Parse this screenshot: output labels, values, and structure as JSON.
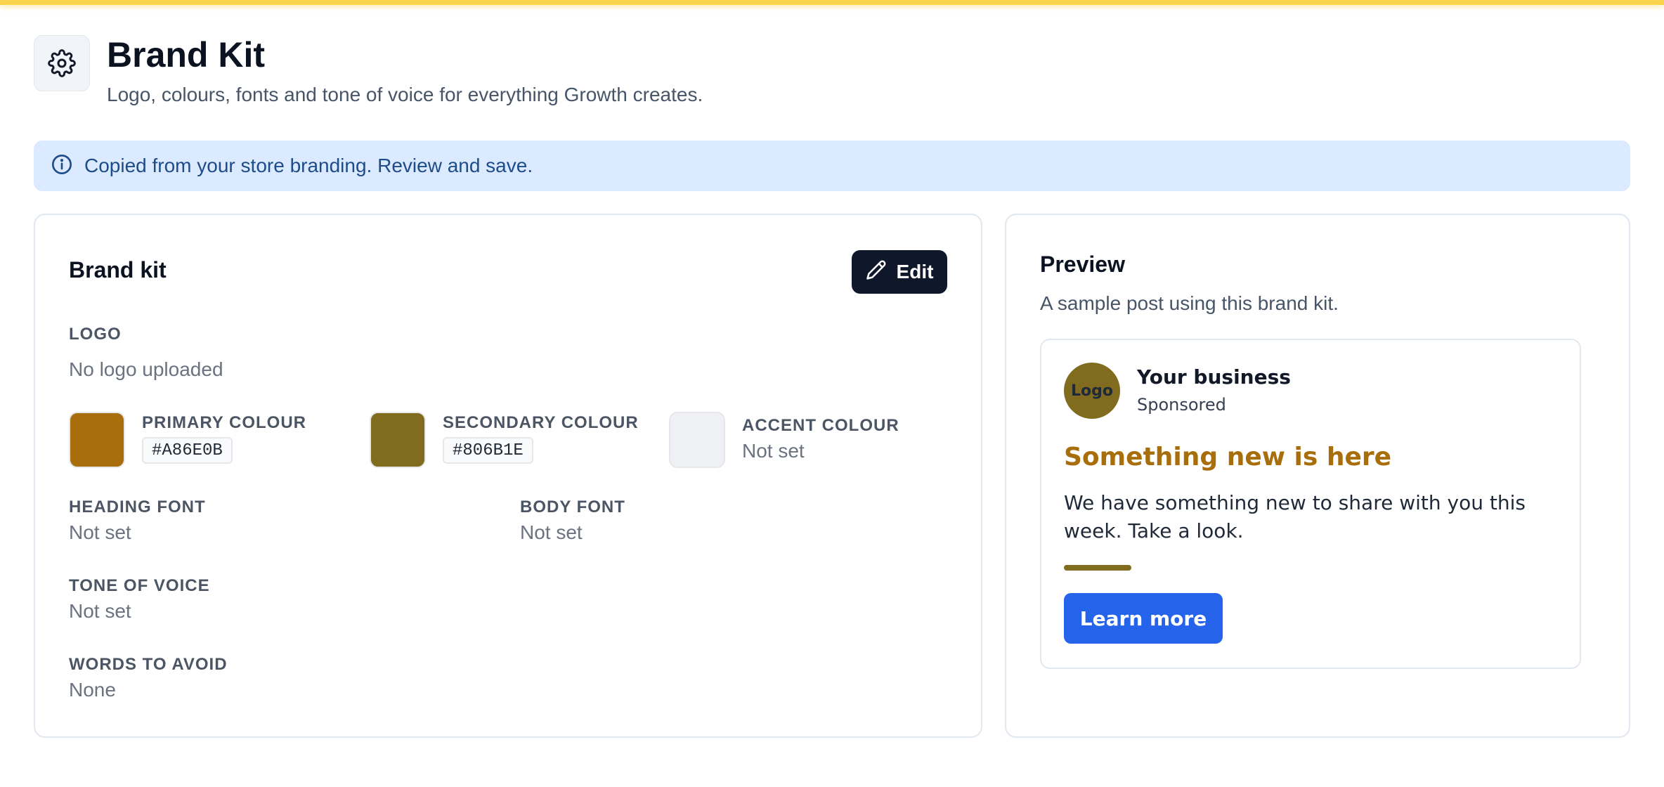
{
  "header": {
    "title": "Brand Kit",
    "subtitle": "Logo, colours, fonts and tone of voice for everything Growth creates.",
    "icon": "gear-icon"
  },
  "banner": {
    "icon": "info-icon",
    "text": "Copied from your store branding. Review and save."
  },
  "brand_kit": {
    "title": "Brand kit",
    "edit_label": "Edit",
    "logo": {
      "label": "LOGO",
      "value": "No logo uploaded"
    },
    "colours": [
      {
        "label": "PRIMARY COLOUR",
        "value": "#A86E0B",
        "color": "#A86E0B"
      },
      {
        "label": "SECONDARY COLOUR",
        "value": "#806B1E",
        "color": "#806B1E"
      },
      {
        "label": "ACCENT COLOUR",
        "value": "Not set",
        "color": "#EEF0F3"
      }
    ],
    "heading_font": {
      "label": "HEADING FONT",
      "value": "Not set"
    },
    "body_font": {
      "label": "BODY FONT",
      "value": "Not set"
    },
    "tone_of_voice": {
      "label": "TONE OF VOICE",
      "value": "Not set"
    },
    "words_to_avoid": {
      "label": "WORDS TO AVOID",
      "value": "None"
    }
  },
  "preview": {
    "title": "Preview",
    "subtitle": "A sample post using this brand kit.",
    "post": {
      "logo_text": "Logo",
      "business_name": "Your business",
      "sponsored": "Sponsored",
      "headline": "Something new is here",
      "body": "We have something new to share with you this week. Take a look.",
      "cta": "Learn more",
      "cta_color": "#2563EB"
    }
  }
}
